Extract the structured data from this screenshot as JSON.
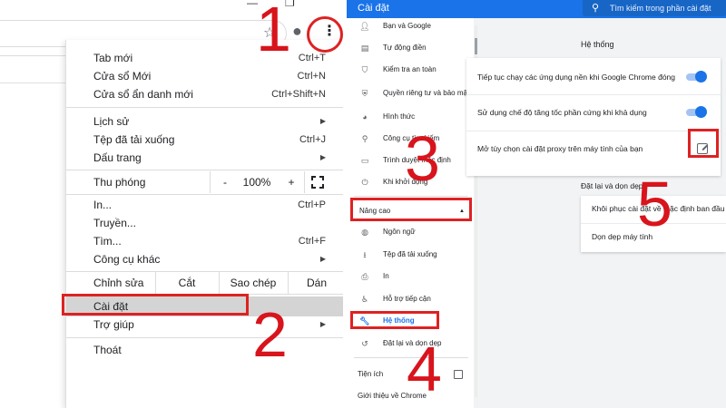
{
  "colors": {
    "accent": "#1a73e8",
    "annotation": "#d8141c"
  },
  "left": {
    "menu": {
      "group1": [
        {
          "label": "Tab mới",
          "shortcut": "Ctrl+T"
        },
        {
          "label": "Cửa sổ Mới",
          "shortcut": "Ctrl+N"
        },
        {
          "label": "Cửa sổ ẩn danh mới",
          "shortcut": "Ctrl+Shift+N"
        }
      ],
      "group2": [
        {
          "label": "Lịch sử",
          "shortcut": ""
        },
        {
          "label": "Tệp đã tải xuống",
          "shortcut": "Ctrl+J"
        },
        {
          "label": "Dấu trang",
          "shortcut": ""
        }
      ],
      "zoom": {
        "label": "Thu phóng",
        "minus": "-",
        "value": "100%",
        "plus": "+"
      },
      "group3": [
        {
          "label": "In...",
          "shortcut": "Ctrl+P"
        },
        {
          "label": "Truyền...",
          "shortcut": ""
        },
        {
          "label": "Tìm...",
          "shortcut": "Ctrl+F"
        },
        {
          "label": "Công cụ khác",
          "shortcut": ""
        }
      ],
      "edit": {
        "label": "Chỉnh sửa",
        "cut": "Cắt",
        "copy": "Sao chép",
        "paste": "Dán"
      },
      "settings": "Cài đặt",
      "help": "Trợ giúp",
      "exit": "Thoát"
    }
  },
  "right": {
    "header": {
      "title": "Cài đặt",
      "search_placeholder": "Tìm kiếm trong phần cài đặt"
    },
    "sidebar": {
      "items": [
        {
          "icon": "person-icon",
          "label": "Bạn và Google"
        },
        {
          "icon": "clipboard-icon",
          "label": "Tự động điền"
        },
        {
          "icon": "shield-check-icon",
          "label": "Kiểm tra an toàn"
        },
        {
          "icon": "shield-icon",
          "label": "Quyền riêng tư và bảo mật"
        },
        {
          "icon": "palette-icon",
          "label": "Hình thức"
        },
        {
          "icon": "search-icon",
          "label": "Công cụ tìm kiếm"
        },
        {
          "icon": "browser-icon",
          "label": "Trình duyệt mặc định"
        },
        {
          "icon": "power-icon",
          "label": "Khi khởi động"
        }
      ],
      "advanced_label": "Nâng cao",
      "advanced_items": [
        {
          "icon": "globe-icon",
          "label": "Ngôn ngữ"
        },
        {
          "icon": "download-icon",
          "label": "Tệp đã tải xuống"
        },
        {
          "icon": "printer-icon",
          "label": "In"
        },
        {
          "icon": "accessibility-icon",
          "label": "Hỗ trợ tiếp cận"
        },
        {
          "icon": "wrench-icon",
          "label": "Hệ thống"
        },
        {
          "icon": "restore-icon",
          "label": "Đặt lại và dọn dẹp"
        }
      ],
      "extensions_label": "Tiện ích",
      "about_label": "Giới thiệu về Chrome"
    },
    "main": {
      "system_title": "Hệ thống",
      "system_rows": [
        "Tiếp tục chạy các ứng dụng nền khi Google Chrome đóng",
        "Sử dụng chế độ tăng tốc phần cứng khi khả dụng",
        "Mở tùy chọn cài đặt proxy trên máy tính của bạn"
      ],
      "reset_title": "Đặt lại và dọn dẹp",
      "reset_rows": [
        "Khôi phục cài đặt về mặc định ban đầu",
        "Dọn dẹp máy tính"
      ]
    }
  },
  "annotations": [
    "1",
    "2",
    "3",
    "4",
    "5"
  ]
}
